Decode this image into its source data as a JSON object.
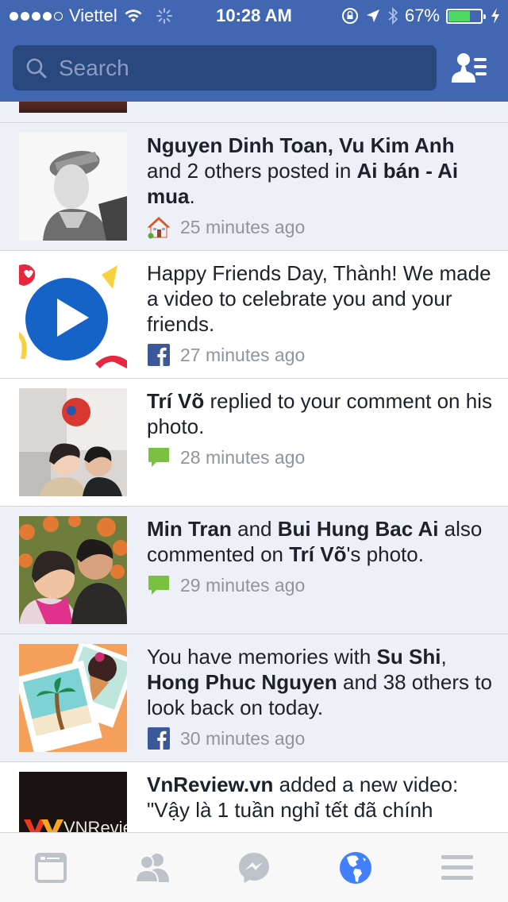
{
  "status_bar": {
    "carrier": "Viettel",
    "signal_bars_filled": 4,
    "signal_bars_total": 5,
    "time": "10:28 AM",
    "battery_percent_label": "67%",
    "battery_level": 0.67,
    "icons": [
      "wifi-icon",
      "activity-spinner-icon",
      "rotation-lock-icon",
      "location-arrow-icon",
      "bluetooth-icon",
      "battery-icon",
      "charging-bolt-icon"
    ]
  },
  "header": {
    "search_placeholder": "Search",
    "search_value": "",
    "right_button_icon": "friend-requests-icon"
  },
  "colors": {
    "brand": "#4267b2",
    "search_bg": "#29487d",
    "unread_bg": "#edf0f7",
    "active_tab": "#4080ff",
    "inactive_tab": "#bec2c9",
    "comment_green": "#7ac142"
  },
  "notifications": [
    {
      "state": "unread",
      "thumbnail": "profile-photo-grayscale-cap",
      "segments": [
        {
          "t": "Nguyen Dinh Toan, Vu Kim Anh",
          "b": true
        },
        {
          "t": " and 2 others posted in ",
          "b": false
        },
        {
          "t": "Ai bán - Ai mua",
          "b": true
        },
        {
          "t": ".",
          "b": false
        }
      ],
      "icon": "group-house-icon",
      "time": "25 minutes ago"
    },
    {
      "state": "read",
      "thumbnail": "friends-day-video-play",
      "segments": [
        {
          "t": "Happy Friends Day, Thành! We made a video to celebrate you and your friends.",
          "b": false
        }
      ],
      "icon": "facebook-icon",
      "time": "27 minutes ago"
    },
    {
      "state": "read",
      "thumbnail": "two-friends-photo",
      "segments": [
        {
          "t": "Trí Võ",
          "b": true
        },
        {
          "t": " replied to your comment on his photo.",
          "b": false
        }
      ],
      "icon": "comment-icon",
      "time": "28 minutes ago"
    },
    {
      "state": "unread",
      "thumbnail": "couple-flowers-photo",
      "segments": [
        {
          "t": "Min Tran",
          "b": true
        },
        {
          "t": " and ",
          "b": false
        },
        {
          "t": "Bui Hung Bac Ai",
          "b": true
        },
        {
          "t": " also commented on ",
          "b": false
        },
        {
          "t": "Trí Võ",
          "b": true
        },
        {
          "t": "'s photo.",
          "b": false
        }
      ],
      "icon": "comment-icon",
      "time": "29 minutes ago"
    },
    {
      "state": "unread",
      "thumbnail": "memories-polaroids",
      "segments": [
        {
          "t": "You have memories with ",
          "b": false
        },
        {
          "t": "Su Shi",
          "b": true
        },
        {
          "t": ", ",
          "b": false
        },
        {
          "t": "Hong Phuc Nguyen",
          "b": true
        },
        {
          "t": " and 38 others to look back on today.",
          "b": false
        }
      ],
      "icon": "facebook-icon",
      "time": "30 minutes ago"
    },
    {
      "state": "read",
      "thumbnail": "vnreview-logo",
      "thumbnail_text": "VNReview",
      "segments": [
        {
          "t": "VnReview.vn",
          "b": true
        },
        {
          "t": " added a new video: \"Vậy là 1 tuần nghỉ tết đã chính",
          "b": false
        }
      ],
      "icon": "",
      "time": ""
    }
  ],
  "tabbar": {
    "tabs": [
      {
        "name": "news-feed",
        "icon": "news-feed-icon",
        "active": false
      },
      {
        "name": "friend-requests",
        "icon": "friends-icon",
        "active": false
      },
      {
        "name": "messenger",
        "icon": "messenger-icon",
        "active": false
      },
      {
        "name": "notifications",
        "icon": "globe-icon",
        "active": true
      },
      {
        "name": "more",
        "icon": "menu-icon",
        "active": false
      }
    ]
  }
}
